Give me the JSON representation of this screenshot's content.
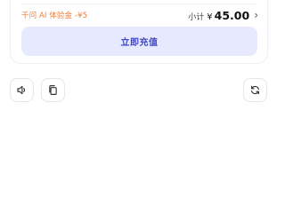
{
  "order_card": {
    "discount_label": "千问 AI 体验金",
    "discount_amount": "-¥5",
    "subtotal_label": "小计",
    "currency_symbol": "¥",
    "subtotal_amount": "45.00",
    "chevron": "›",
    "recharge_button": "立即充值"
  },
  "actions": {
    "left": [
      {
        "name": "speaker-icon"
      },
      {
        "name": "copy-icon"
      }
    ],
    "right": [
      {
        "name": "refresh-icon"
      }
    ]
  },
  "colors": {
    "discount": "#ef7d3c",
    "button_bg": "#e7e9ff",
    "button_text": "#3f46c6"
  }
}
